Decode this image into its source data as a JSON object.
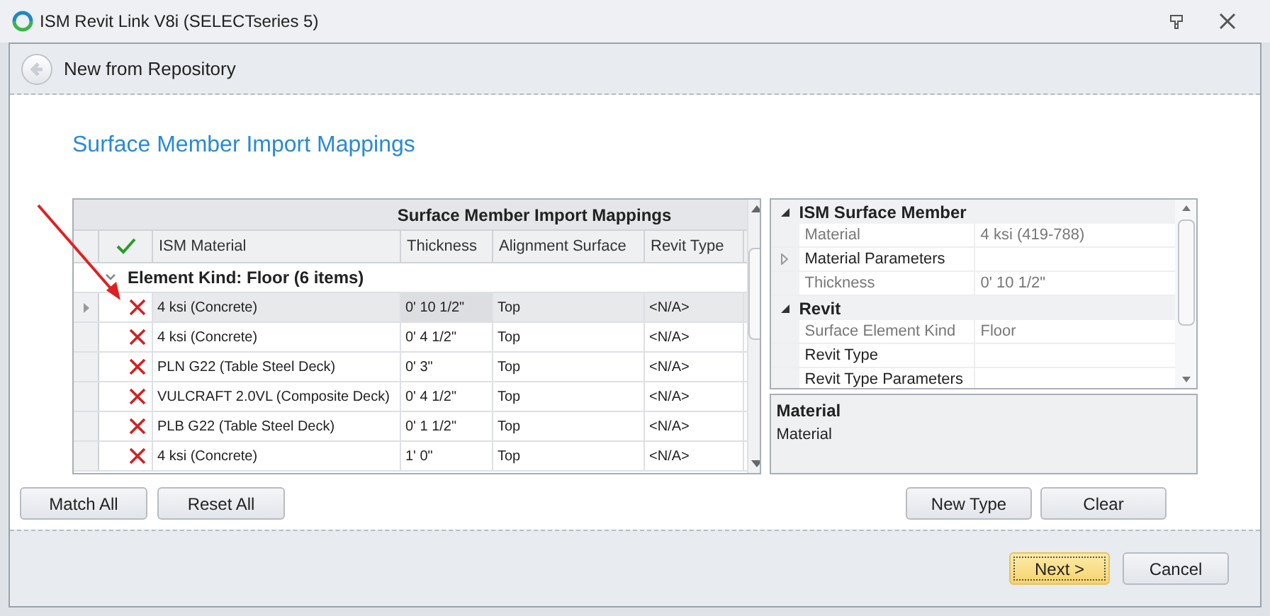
{
  "window": {
    "title": "ISM Revit Link V8i (SELECTseries 5)"
  },
  "header": {
    "title": "New from Repository"
  },
  "page_title": "Surface Member Import Mappings",
  "grid": {
    "band_title": "Surface Member Import Mappings",
    "columns": [
      "ISM Material",
      "Thickness",
      "Alignment Surface",
      "Revit Type"
    ],
    "group": {
      "label": "Element Kind: Floor (6 items)",
      "expanded": true
    },
    "rows": [
      {
        "selected": true,
        "matched": false,
        "cells": [
          "4 ksi (Concrete)",
          "0' 10 1/2\"",
          "Top",
          "<N/A>"
        ]
      },
      {
        "selected": false,
        "matched": false,
        "cells": [
          "4 ksi (Concrete)",
          "0' 4 1/2\"",
          "Top",
          "<N/A>"
        ]
      },
      {
        "selected": false,
        "matched": false,
        "cells": [
          "PLN G22 (Table Steel Deck)",
          "0' 3\"",
          "Top",
          "<N/A>"
        ]
      },
      {
        "selected": false,
        "matched": false,
        "cells": [
          "VULCRAFT 2.0VL (Composite Deck)",
          "0' 4 1/2\"",
          "Top",
          "<N/A>"
        ]
      },
      {
        "selected": false,
        "matched": false,
        "cells": [
          "PLB G22 (Table Steel Deck)",
          "0' 1 1/2\"",
          "Top",
          "<N/A>"
        ]
      },
      {
        "selected": false,
        "matched": false,
        "cells": [
          "4 ksi (Concrete)",
          "1' 0\"",
          "Top",
          "<N/A>"
        ]
      }
    ]
  },
  "properties": {
    "categories": [
      {
        "name": "ISM Surface Member",
        "expanded": true,
        "items": [
          {
            "name": "Material",
            "value": "4 ksi (419-788)",
            "readonly": true,
            "expandable": false
          },
          {
            "name": "Material Parameters",
            "readonly": false,
            "expandable": true
          },
          {
            "name": "Thickness",
            "value": "0' 10 1/2\"",
            "readonly": true,
            "expandable": false
          }
        ]
      },
      {
        "name": "Revit",
        "expanded": true,
        "items": [
          {
            "name": "Surface Element Kind",
            "value": "Floor",
            "readonly": true,
            "expandable": false
          },
          {
            "name": "Revit Type",
            "readonly": false,
            "expandable": false
          },
          {
            "name": "Revit Type Parameters",
            "readonly": false,
            "expandable": false
          }
        ]
      }
    ],
    "description": {
      "title": "Material",
      "text": "Material"
    }
  },
  "grid_buttons": [
    "Match All",
    "Reset All"
  ],
  "property_buttons": [
    "New Type",
    "Clear"
  ],
  "footer_buttons": [
    {
      "label": "Next >",
      "kind": "default"
    },
    {
      "label": "Cancel",
      "kind": "normal"
    }
  ]
}
